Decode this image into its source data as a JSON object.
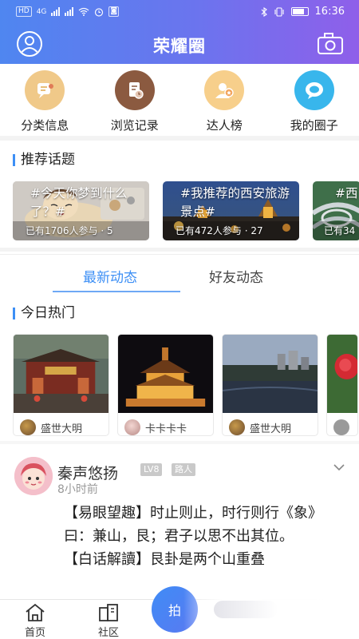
{
  "status_bar": {
    "left_chips": [
      "HD",
      "4G",
      "HD"
    ],
    "time": "16:36",
    "icons": [
      "bluetooth-icon",
      "vibrate-icon",
      "battery-icon"
    ]
  },
  "header": {
    "title": "荣耀圈",
    "left_icon": "user-icon",
    "right_icon": "camera-icon",
    "gradient": [
      "#4f86f0",
      "#8f5fea"
    ]
  },
  "shortcuts": [
    {
      "label": "分类信息",
      "icon": "message-icon",
      "color": "#f0c989"
    },
    {
      "label": "浏览记录",
      "icon": "history-icon",
      "color": "#8b5a40"
    },
    {
      "label": "达人榜",
      "icon": "ranking-icon",
      "color": "#f7cf8b"
    },
    {
      "label": "我的圈子",
      "icon": "circle-icon",
      "color": "#38b6ec"
    }
  ],
  "recommend": {
    "title": "推荐话题",
    "topics": [
      {
        "text": "#今天你梦到什么了？#",
        "meta": "已有1706人参与 · 5"
      },
      {
        "text": "#我推荐的西安旅游景点#",
        "meta": "已有472人参与 · 27"
      },
      {
        "text": "#西",
        "meta": "已有34"
      }
    ]
  },
  "tabs": [
    {
      "label": "最新动态",
      "active": true
    },
    {
      "label": "好友动态",
      "active": false
    }
  ],
  "hot": {
    "title": "今日热门",
    "items": [
      {
        "author": "盛世大明"
      },
      {
        "author": "卡卡卡卡"
      },
      {
        "author": "盛世大明"
      },
      {
        "author": ""
      }
    ]
  },
  "post": {
    "author": "秦声悠扬",
    "level": "LV8",
    "role": "路人",
    "time": "8小时前",
    "paragraphs": [
      "【易眼望趣】时止则止，时行则行《象》曰：兼山，艮；君子以思不出其位。",
      "【白话解讀】艮卦是两个山重叠"
    ]
  },
  "bottom_nav": {
    "items": [
      {
        "label": "首页",
        "icon": "home-icon"
      },
      {
        "label": "社区",
        "icon": "community-icon"
      }
    ],
    "fab_label": "拍"
  },
  "colors": {
    "accent": "#3d8ff5",
    "muted": "#999999"
  }
}
